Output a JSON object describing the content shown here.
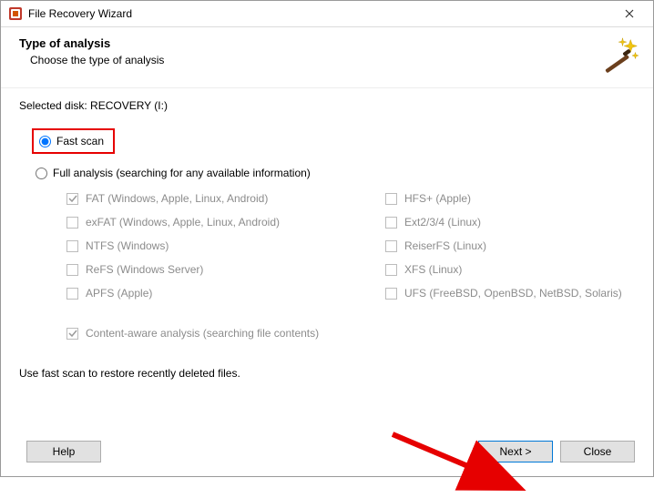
{
  "window": {
    "title": "File Recovery Wizard"
  },
  "header": {
    "heading": "Type of analysis",
    "subheading": "Choose the type of analysis"
  },
  "selected_disk_label": "Selected disk: RECOVERY (I:)",
  "scan": {
    "fast_label": "Fast scan",
    "full_label": "Full analysis (searching for any available information)"
  },
  "filesystems": {
    "left": [
      {
        "label": "FAT (Windows, Apple, Linux, Android)",
        "checked": true
      },
      {
        "label": "exFAT (Windows, Apple, Linux, Android)",
        "checked": false
      },
      {
        "label": "NTFS (Windows)",
        "checked": false
      },
      {
        "label": "ReFS (Windows Server)",
        "checked": false
      },
      {
        "label": "APFS (Apple)",
        "checked": false
      }
    ],
    "right": [
      {
        "label": "HFS+ (Apple)",
        "checked": false
      },
      {
        "label": "Ext2/3/4 (Linux)",
        "checked": false
      },
      {
        "label": "ReiserFS (Linux)",
        "checked": false
      },
      {
        "label": "XFS (Linux)",
        "checked": false
      },
      {
        "label": "UFS (FreeBSD, OpenBSD, NetBSD, Solaris)",
        "checked": false
      }
    ]
  },
  "content_aware": {
    "label": "Content-aware analysis (searching file contents)",
    "checked": true
  },
  "hint": "Use fast scan to restore recently deleted files.",
  "buttons": {
    "help": "Help",
    "next": "Next >",
    "close": "Close"
  }
}
